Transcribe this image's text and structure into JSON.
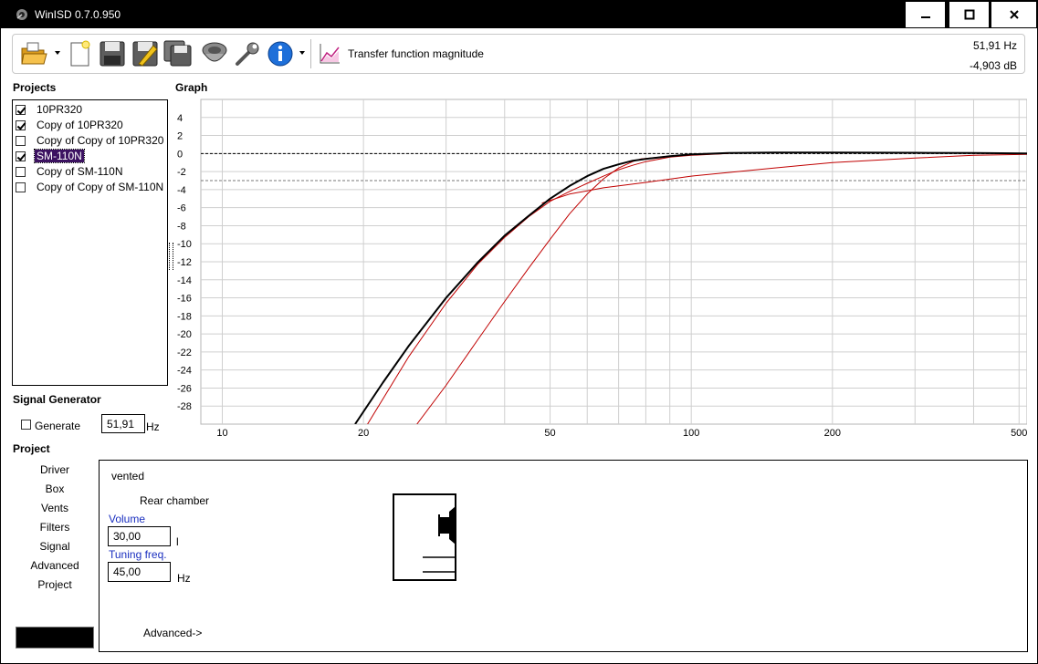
{
  "window": {
    "title": "WinISD 0.7.0.950",
    "minimize_icon": "minimize-icon",
    "maximize_icon": "maximize-icon",
    "close_icon": "close-icon"
  },
  "toolbar": {
    "icons": [
      "open-folder-icon",
      "new-document-icon",
      "save-icon",
      "save-as-icon",
      "save-all-icon",
      "driver-icon",
      "wrench-icon",
      "info-icon"
    ],
    "graph_type_icon": "graph-icon",
    "graph_type": "Transfer function magnitude",
    "readout_freq": "51,91 Hz",
    "readout_level": "-4,903 dB"
  },
  "projects": {
    "label": "Projects",
    "items": [
      {
        "name": "10PR320",
        "checked": true,
        "selected": false
      },
      {
        "name": "Copy of 10PR320",
        "checked": true,
        "selected": false
      },
      {
        "name": "Copy of Copy of 10PR320",
        "checked": false,
        "selected": false
      },
      {
        "name": "SM-110N",
        "checked": true,
        "selected": true
      },
      {
        "name": "Copy of SM-110N",
        "checked": false,
        "selected": false
      },
      {
        "name": "Copy of Copy of SM-110N",
        "checked": false,
        "selected": false
      }
    ]
  },
  "graph": {
    "label": "Graph",
    "chart_data": {
      "type": "line",
      "x_scale": "log",
      "xlim": [
        9,
        520
      ],
      "ylim": [
        -30,
        6
      ],
      "x_ticks": [
        10,
        20,
        50,
        100,
        200,
        500
      ],
      "x_tick_labels": [
        "10",
        "20",
        "50",
        "100",
        "200",
        "500"
      ],
      "y_ticks": [
        4,
        2,
        0,
        -2,
        -4,
        -6,
        -8,
        -10,
        -12,
        -14,
        -16,
        -18,
        -20,
        -22,
        -24,
        -26,
        -28
      ],
      "y_tick_labels": [
        "4",
        "2",
        "0",
        "-2",
        "-4",
        "-6",
        "-8",
        "-10",
        "-12",
        "-14",
        "-16",
        "-18",
        "-20",
        "-22",
        "-24",
        "-26",
        "-28"
      ],
      "grid": true,
      "reference_lines": [
        {
          "y": 0,
          "style": "dashed",
          "color": "#000000"
        },
        {
          "y": -3,
          "style": "dashed",
          "color": "#777777"
        }
      ],
      "series": [
        {
          "color": "#000000",
          "width": 2,
          "x": [
            19.2,
            22,
            25,
            30,
            35,
            40,
            45,
            50,
            55,
            60,
            65,
            70,
            75,
            80,
            90,
            100,
            120,
            150,
            200,
            300,
            400,
            520
          ],
          "y": [
            -30,
            -25.4,
            -21.3,
            -16.0,
            -12.1,
            -9.1,
            -6.9,
            -5.0,
            -3.6,
            -2.5,
            -1.7,
            -1.2,
            -0.8,
            -0.6,
            -0.3,
            -0.1,
            0.05,
            0.1,
            0.1,
            0.08,
            0.05,
            0.0
          ]
        },
        {
          "color": "#c00000",
          "width": 1,
          "x": [
            20.4,
            25,
            30,
            35,
            40,
            45,
            50,
            55,
            60,
            65,
            70,
            75,
            80,
            90,
            100,
            120
          ],
          "y": [
            -30,
            -22.5,
            -16.6,
            -12.3,
            -9.3,
            -7.0,
            -5.3,
            -4.2,
            -3.3,
            -2.5,
            -1.8,
            -1.3,
            -0.9,
            -0.4,
            -0.2,
            0.0
          ]
        },
        {
          "color": "#c00000",
          "width": 1,
          "x": [
            26,
            30,
            35,
            40,
            45,
            50,
            55,
            60,
            65,
            70,
            75,
            78,
            90,
            100,
            120
          ],
          "y": [
            -30,
            -25.7,
            -20.7,
            -16.4,
            -12.7,
            -9.5,
            -6.7,
            -4.5,
            -2.8,
            -1.6,
            -0.9,
            -0.6,
            -0.3,
            -0.15,
            0.0
          ]
        },
        {
          "color": "#c00000",
          "width": 1,
          "x": [
            48,
            55,
            65,
            80,
            100,
            150,
            200,
            300,
            400,
            520
          ],
          "y": [
            -5.5,
            -4.5,
            -3.8,
            -3.2,
            -2.5,
            -1.6,
            -1.0,
            -0.5,
            -0.2,
            -0.1
          ]
        }
      ]
    }
  },
  "signal_generator": {
    "label": "Signal Generator",
    "generate_label": "Generate",
    "generate_checked": false,
    "frequency": "51,91",
    "unit": "Hz"
  },
  "project": {
    "label": "Project",
    "nav": [
      "Driver",
      "Box",
      "Vents",
      "Filters",
      "Signal",
      "Advanced",
      "Project"
    ],
    "box_type": "vented",
    "chamber_label": "Rear chamber",
    "volume_label": "Volume",
    "volume_value": "30,00",
    "volume_unit": "l",
    "tuning_label": "Tuning freq.",
    "tuning_value": "45,00",
    "tuning_unit": "Hz",
    "advanced_link": "Advanced->",
    "box_diagram_icon": "vented-box-diagram-icon"
  }
}
